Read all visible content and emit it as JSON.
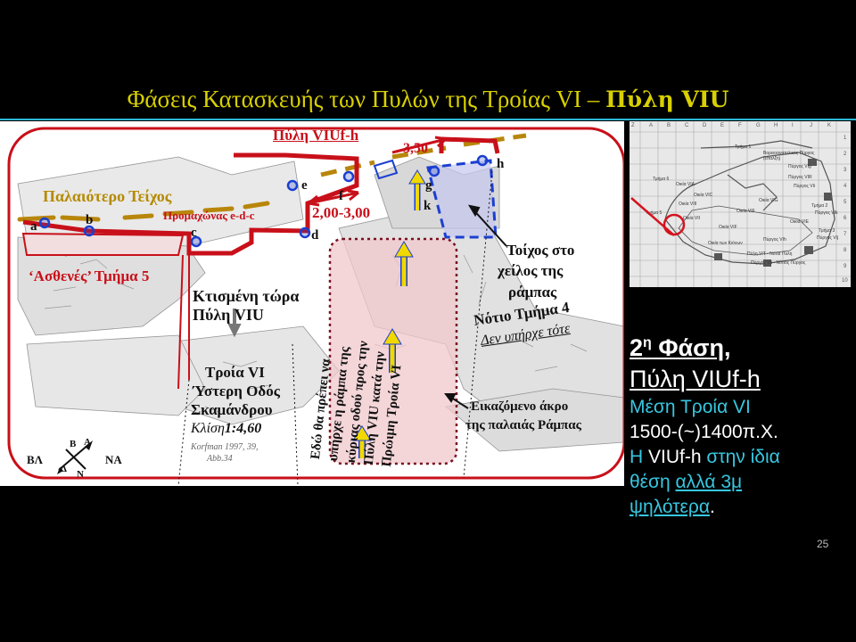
{
  "slide": {
    "title_main": "Φάσεις Κατασκευής των Πυλών της Τροίας VI – ",
    "title_bold": "Πύλη VIU",
    "page_number": "25"
  },
  "plan": {
    "labels": {
      "gate_name": "Πύλη VIUf-h",
      "dim_350": "3,50",
      "older_wall": "Παλαιότερο Τείχος",
      "bastion": "Προμαχώνας e-d-c",
      "dim_200_300": "2,00-3,00",
      "weak_section": "‘Ασθενές’ Τμήμα 5",
      "built_now_1": "Κτισμένη τώρα",
      "built_now_2": "Πύλη VIU",
      "troy_1": "Τροία VI",
      "troy_2": "Ύστερη Οδός",
      "troy_3": "Σκαμάνδρου",
      "slope_prefix": "Κλίση",
      "slope_value": "1:4,60",
      "ref_1": "Korfman 1997, 39,",
      "ref_2": "Abb.34",
      "wall_ramp_1": "Τοίχος στο",
      "wall_ramp_2": "χείλος της",
      "wall_ramp_3": "ράμπας",
      "south_1": "Νότιο Τμήμα 4",
      "south_2": "Δεν υπήρχε τότε",
      "ramp_end_1": "Εικαζόμενο άκρο",
      "ramp_end_2": "της παλαιάς Ράμπας",
      "rot_1": "Εδώ θα πρέπει να",
      "rot_2": "υπήρχε η ράμπα της",
      "rot_3": "κύριας οδού προς",
      "rot_4": "την",
      "rot_5": "Πύλη VIU κατά την",
      "rot_6": "Πρώιμη Τροία VI",
      "compass_left": "ΒΛ",
      "compass_right": "ΝΑ",
      "compass_n": "Β",
      "compass_s": "Ν",
      "compass_a": "Α",
      "compass_d": "Δ"
    },
    "points": [
      "a",
      "b",
      "c",
      "d",
      "e",
      "f",
      "g",
      "k",
      "h"
    ]
  },
  "inset_map": {
    "col_labels": [
      "Z",
      "A",
      "B",
      "C",
      "D",
      "E",
      "F",
      "G",
      "H",
      "I",
      "J",
      "K"
    ],
    "row_labels": [
      "1",
      "2",
      "3",
      "4",
      "5",
      "6",
      "7",
      "8",
      "9",
      "10"
    ],
    "texts": [
      "Τμήμα 1",
      "Βορειοανατολικός Πύργος (επαλξη)",
      "Πύργος VIg",
      "Τμήμα 6",
      "Οικία VIA",
      "Πύργος VIR",
      "Πύργος VIi",
      "Οικία VIG",
      "Τμήμα 2",
      "Πύργος VIk",
      "Οικία VIE",
      "Τμήμα 3",
      "Πύργος VIj",
      "Οικία VIII",
      "Οικία VIF",
      "Οικία VIC",
      "Τμήμα 5",
      "Οικία VII",
      "Οικία VIF",
      "Πύργος VIh",
      "Οικία των Κιόνων",
      "Πύλη VIT - Νότια Πύλη",
      "Πύργος VIi - Νότιος Πύργος"
    ],
    "accent_color": "#d4141e"
  },
  "side": {
    "phase_num": "2",
    "phase_sup": "η",
    "phase_word": " Φάση",
    "phase_comma": ",",
    "gate": "Πύλη VIUf-h",
    "period": "Μέση Τροία VI",
    "dates": "1500-(~)1400π.Χ.",
    "l1_a": "Η",
    "l1_b": " VIUf-h ",
    "l1_c": "στην ίδια",
    "l2_a": "θέση ",
    "l2_b": "αλλά 3μ",
    "l3_a": "ψηλότερα",
    "l3_b": "."
  },
  "colors": {
    "title": "#d8d000",
    "rule": "#2ab9d8",
    "wall_red": "#c8101a",
    "point_blue": "#1b3fd1",
    "cyan_text": "#37c7e0",
    "gold_arrow": "#f0d800"
  }
}
